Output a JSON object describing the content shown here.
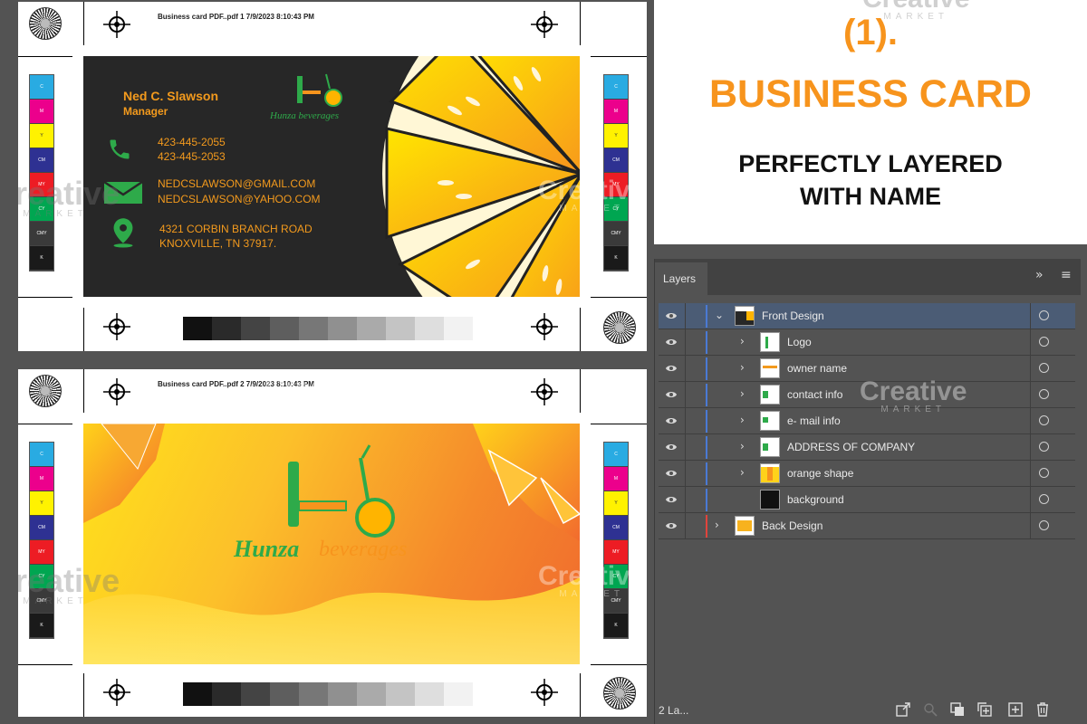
{
  "sheet1": {
    "header": "Business card PDF..pdf   1   7/9/2023   8:10:43 PM"
  },
  "sheet2": {
    "header": "Business card PDF..pdf   2   7/9/2023   8:10:43 PM"
  },
  "color_bar_labels": [
    "C",
    "M",
    "Y",
    "CM",
    "MY",
    "CY",
    "CMY",
    "K"
  ],
  "color_bar_colors": [
    "#29abe2",
    "#ec008c",
    "#fff200",
    "#2e3192",
    "#ed1c24",
    "#00a651",
    "#3a3a3a",
    "#1a1a1a"
  ],
  "gray_steps": [
    "#111111",
    "#2a2a2a",
    "#444444",
    "#5e5e5e",
    "#777777",
    "#909090",
    "#aaaaaa",
    "#c4c4c4",
    "#dedede",
    "#f2f2f2"
  ],
  "front_card": {
    "name": "Ned C. Slawson",
    "title": "Manager",
    "phone1": "423-445-2055",
    "phone2": "423-445-2053",
    "email1": "NEDCSLAWSON@GMAIL.COM",
    "email2": "NEDCSLAWSON@YAHOO.COM",
    "address1": "4321 CORBIN BRANCH ROAD",
    "address2": "KNOXVILLE, TN 37917.",
    "brand": "Hunza beverages",
    "accent": "#f39a1d",
    "icon_color": "#2eaa4a"
  },
  "back_card": {
    "brand_part1": "Hunza",
    "brand_part2": "beverages"
  },
  "promo": {
    "number": "(1).",
    "title": "BUSINESS CARD",
    "line1": "PERFECTLY LAYERED",
    "line2": "WITH NAME",
    "accent": "#f7941d"
  },
  "layers_panel": {
    "tab": "Layers",
    "count": "2 La...",
    "rows": [
      {
        "label": "Front Design",
        "selected": true
      },
      {
        "label": "Logo"
      },
      {
        "label": "owner name"
      },
      {
        "label": "contact info"
      },
      {
        "label": "e- mail info"
      },
      {
        "label": "ADDRESS OF COMPANY"
      },
      {
        "label": "orange shape"
      },
      {
        "label": "background"
      },
      {
        "label": "Back Design"
      }
    ]
  },
  "watermark": {
    "word1": "Creative",
    "word2": "MARKET"
  }
}
